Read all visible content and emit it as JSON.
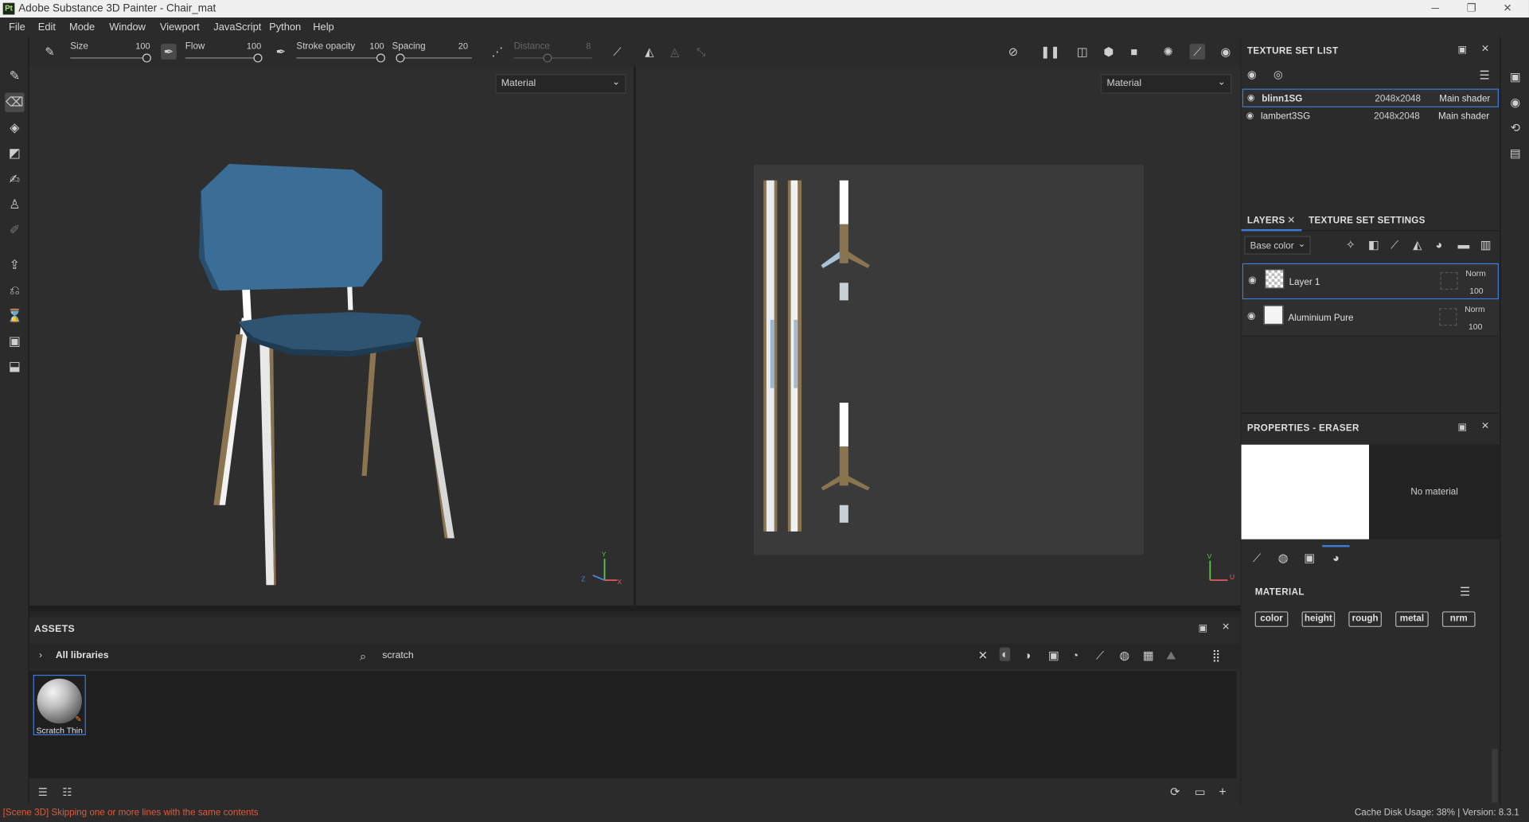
{
  "window": {
    "title": "Adobe Substance 3D Painter - Chair_mat",
    "logo": "Pt",
    "controls": [
      "─",
      "❐",
      "✕"
    ]
  },
  "menu": [
    "File",
    "Edit",
    "Mode",
    "Window",
    "Viewport",
    "JavaScript",
    "Python",
    "Help"
  ],
  "toolbar": {
    "size_label": "Size",
    "size_value": "100",
    "flow_label": "Flow",
    "flow_value": "100",
    "stroke_label": "Stroke opacity",
    "stroke_value": "100",
    "spacing_label": "Spacing",
    "spacing_value": "20",
    "distance_label": "Distance",
    "distance_value": "8"
  },
  "viewports": {
    "left_mode": "Material",
    "right_mode": "Material",
    "axis_3d": {
      "y": "Y",
      "z": "Z",
      "x": "X"
    },
    "axis_2d": {
      "v": "V",
      "u": "U"
    }
  },
  "assets": {
    "header": "ASSETS",
    "library": "All libraries",
    "search_value": "scratch",
    "items": [
      {
        "name": "Scratch Thin"
      }
    ]
  },
  "texture_set_list": {
    "title": "TEXTURE SET LIST",
    "rows": [
      {
        "name": "blinn1SG",
        "resolution": "2048x2048",
        "shader": "Main shader",
        "selected": true
      },
      {
        "name": "lambert3SG",
        "resolution": "2048x2048",
        "shader": "Main shader",
        "selected": false
      }
    ]
  },
  "layers_panel": {
    "tab_layers": "LAYERS",
    "tab_tss": "TEXTURE SET SETTINGS",
    "channel": "Base color",
    "layers": [
      {
        "name": "Layer 1",
        "blend": "Norm",
        "opacity": "100",
        "selected": true
      },
      {
        "name": "Aluminium Pure",
        "blend": "Norm",
        "opacity": "100",
        "selected": false
      }
    ]
  },
  "properties": {
    "title": "PROPERTIES - ERASER",
    "no_material": "No material",
    "section": "MATERIAL",
    "channels": [
      "color",
      "height",
      "rough",
      "metal",
      "nrm"
    ]
  },
  "status": {
    "message": "[Scene 3D] Skipping one or more lines with the same contents",
    "cache": "Cache Disk Usage:    38% | Version: 8.3.1"
  },
  "colors": {
    "accent": "#3d7bd6",
    "error_text": "#e05a3a",
    "seat_blue": "#2f5f86",
    "wood": "#8a7550"
  }
}
